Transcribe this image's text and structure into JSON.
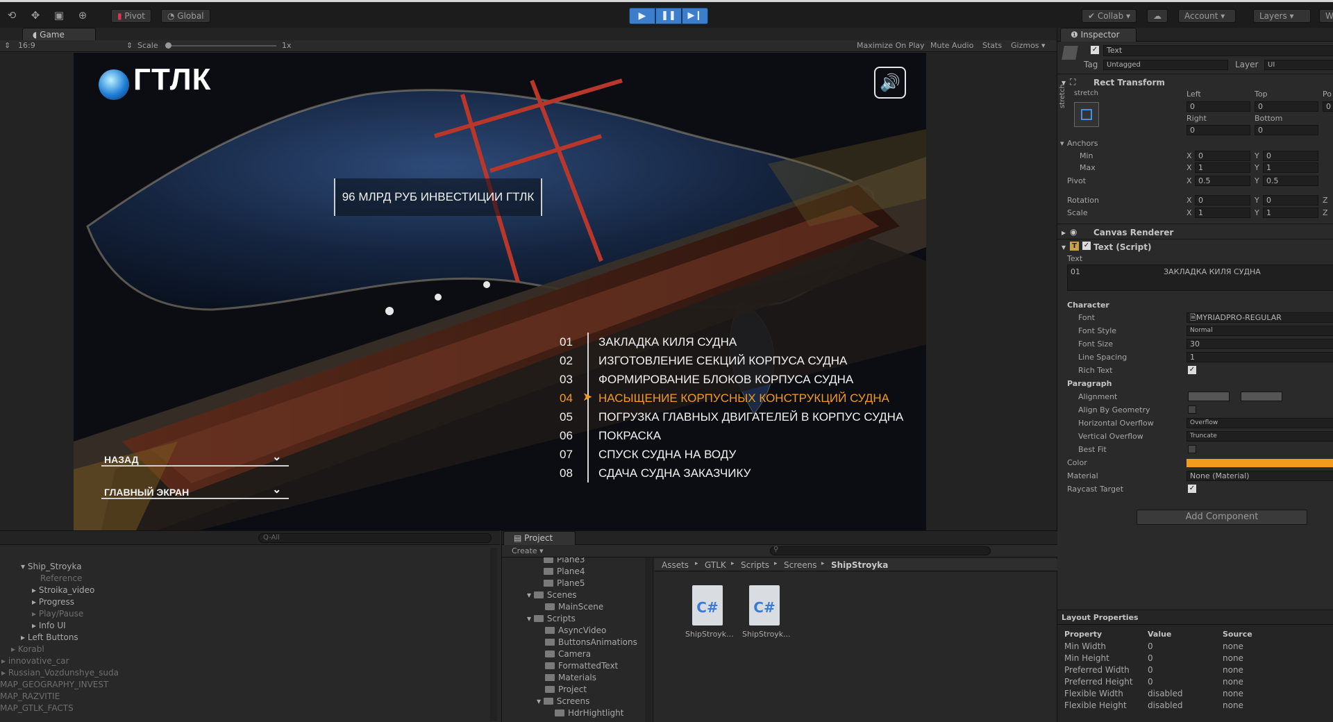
{
  "toolbar": {
    "pivot": "Pivot",
    "global": "Global",
    "collab": "Collab",
    "account": "Account",
    "layers": "Layers",
    "layout": "W"
  },
  "game": {
    "tab": "Game",
    "aspect": "16:9",
    "scale_label": "Scale",
    "scale_value": "1x",
    "opts": [
      "Maximize On Play",
      "Mute Audio",
      "Stats",
      "Gizmos"
    ],
    "logo": "ГТЛК",
    "banner": "96 МЛРД РУБ ИНВЕСТИЦИИ ГТЛК",
    "btn_back": "НАЗАД",
    "btn_main": "ГЛАВНЫЙ ЭКРАН",
    "steps": [
      {
        "n": "01",
        "t": "ЗАКЛАДКА КИЛЯ СУДНА"
      },
      {
        "n": "02",
        "t": "ИЗГОТОВЛЕНИЕ СЕКЦИЙ КОРПУСА СУДНА"
      },
      {
        "n": "03",
        "t": "ФОРМИРОВАНИЕ БЛОКОВ КОРПУСА СУДНА"
      },
      {
        "n": "04",
        "t": "НАСЫЩЕНИЕ КОРПУСНЫХ КОНСТРУКЦИЙ СУДНА",
        "active": true
      },
      {
        "n": "05",
        "t": "ПОГРУЗКА ГЛАВНЫХ ДВИГАТЕЛЕЙ В КОРПУС СУДНА"
      },
      {
        "n": "06",
        "t": "ПОКРАСКА"
      },
      {
        "n": "07",
        "t": "СПУСК СУДНА НА ВОДУ"
      },
      {
        "n": "08",
        "t": "СДАЧА СУДНА ЗАКАЗЧИКУ"
      }
    ],
    "accent": "#f39b1f"
  },
  "inspector": {
    "tab": "Inspector",
    "name": "Text",
    "tag_label": "Tag",
    "tag": "Untagged",
    "layer_label": "Layer",
    "layer": "UI",
    "rect": {
      "title": "Rect Transform",
      "stretch": "stretch",
      "stretch_v": "stretch",
      "left": "Left",
      "top": "Top",
      "pos": "Po",
      "left_v": "0",
      "top_v": "0",
      "pos_v": "0",
      "right": "Right",
      "bottom": "Bottom",
      "right_v": "0",
      "bottom_v": "0",
      "anchors": "Anchors",
      "min": "Min",
      "max": "Max",
      "pivot": "Pivot",
      "rotation": "Rotation",
      "scale": "Scale",
      "x": "X",
      "y": "Y",
      "z": "Z",
      "min_x": "0",
      "min_y": "0",
      "max_x": "1",
      "max_y": "1",
      "pivot_x": "0.5",
      "pivot_y": "0.5",
      "rot_x": "0",
      "rot_y": "0",
      "scale_x": "1",
      "scale_y": "1"
    },
    "canvas_renderer": "Canvas Renderer",
    "text_script": "Text (Script)",
    "text_label": "Text",
    "text_value_n": "01",
    "text_value": "ЗАКЛАДКА КИЛЯ СУДНА",
    "character": "Character",
    "font_label": "Font",
    "font": "MYRIADPRO-REGULAR",
    "font_style_label": "Font Style",
    "font_style": "Normal",
    "font_size_label": "Font Size",
    "font_size": "30",
    "line_spacing_label": "Line Spacing",
    "line_spacing": "1",
    "rich_text_label": "Rich Text",
    "paragraph": "Paragraph",
    "alignment_label": "Alignment",
    "align_geom_label": "Align By Geometry",
    "h_overflow_label": "Horizontal Overflow",
    "h_overflow": "Overflow",
    "v_overflow_label": "Vertical Overflow",
    "v_overflow": "Truncate",
    "best_fit_label": "Best Fit",
    "color_label": "Color",
    "color": "#f39b1f",
    "material_label": "Material",
    "material": "None (Material)",
    "raycast_label": "Raycast Target",
    "add_component": "Add Component"
  },
  "layout_props": {
    "title": "Layout Properties",
    "headers": [
      "Property",
      "Value",
      "Source"
    ],
    "rows": [
      [
        "Min Width",
        "0",
        "none"
      ],
      [
        "Min Height",
        "0",
        "none"
      ],
      [
        "Preferred Width",
        "0",
        "none"
      ],
      [
        "Preferred Height",
        "0",
        "none"
      ],
      [
        "Flexible Width",
        "disabled",
        "none"
      ],
      [
        "Flexible Height",
        "disabled",
        "none"
      ]
    ]
  },
  "hierarchy": {
    "search": "Q-All",
    "items": [
      "Ship_Stroyka",
      "Reference",
      "Stroika_video",
      "Progress",
      "Play/Pause",
      "Info UI",
      "Left Buttons",
      "Korabl",
      "innovative_car",
      "Russian_Vozdunshye_suda",
      "MAP_GEOGRAPHY_INVEST",
      "MAP_RAZVITIE",
      "MAP_GTLK_FACTS"
    ]
  },
  "project": {
    "tab": "Project",
    "create": "Create",
    "breadcrumb": [
      "Assets",
      "GTLK",
      "Scripts",
      "Screens",
      "ShipStroyka"
    ],
    "tree": [
      "Plane3",
      "Plane4",
      "Plane5",
      "Scenes",
      "MainScene",
      "Scripts",
      "AsyncVideo",
      "ButtonsAnimations",
      "Camera",
      "FormattedText",
      "Materials",
      "Project",
      "Screens",
      "HdrHightlight"
    ],
    "files": [
      "ShipStroyk...",
      "ShipStroyk..."
    ],
    "file_icon": "C#"
  }
}
